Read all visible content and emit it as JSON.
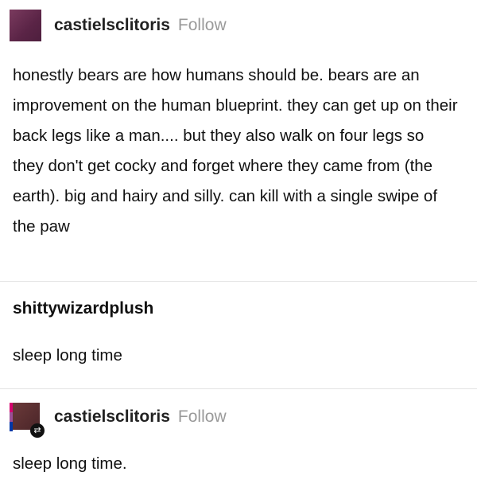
{
  "post1": {
    "username": "castielsclitoris",
    "follow": "Follow",
    "text": "honestly bears are how humans should be. bears are an improvement on the human blueprint. they can get up on their back legs like a man.... but they also walk on four legs so they don't get cocky and forget where they came from (the earth). big and hairy and silly. can kill with a single swipe of the paw"
  },
  "post2": {
    "username": "shittywizardplush",
    "text": "sleep long time"
  },
  "post3": {
    "username": "castielsclitoris",
    "follow": "Follow",
    "text": "sleep long time."
  },
  "colors": {
    "follow": "#9a9a9a",
    "divider": "#e4e4e4",
    "avatar": "#5a2446"
  },
  "icons": [
    "avatar-image",
    "reblog-icon"
  ]
}
